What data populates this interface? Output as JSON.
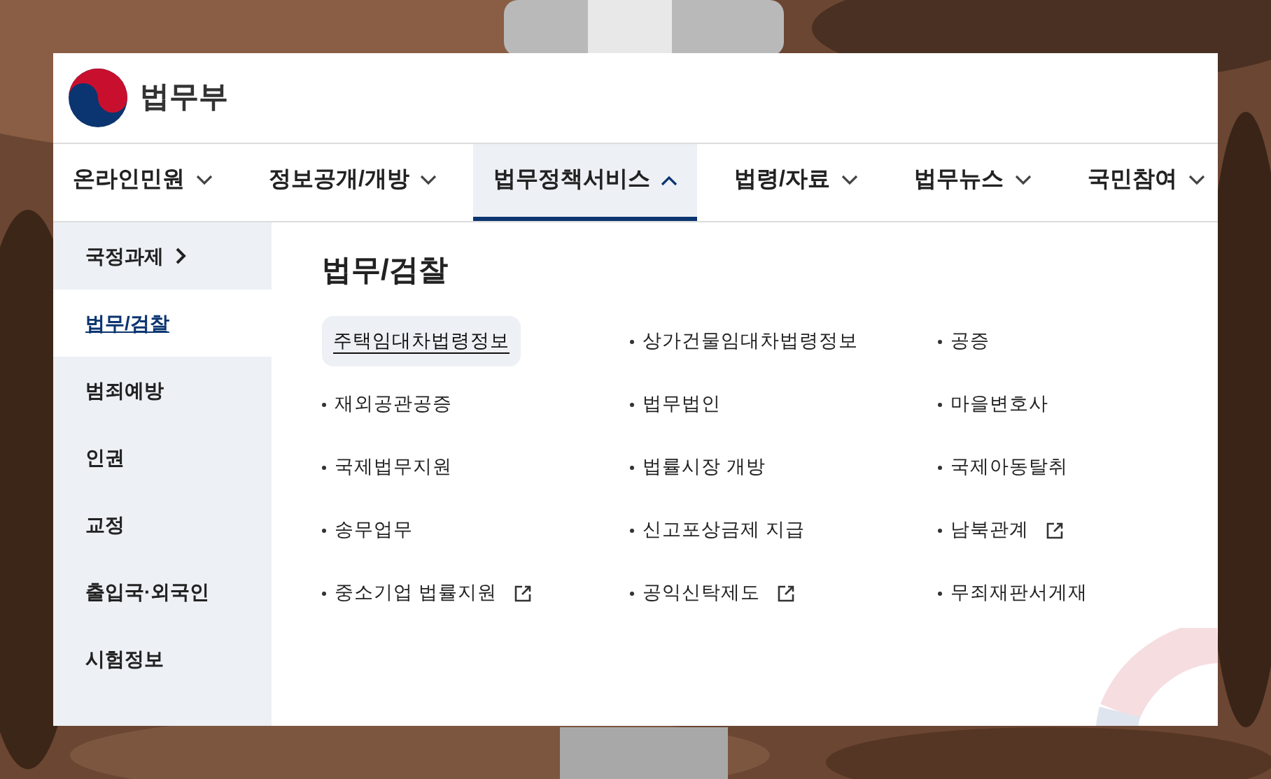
{
  "logo": {
    "name": "법무부"
  },
  "nav": [
    {
      "label": "온라인민원",
      "selected": false,
      "expanded": false
    },
    {
      "label": "정보공개/개방",
      "selected": false,
      "expanded": false
    },
    {
      "label": "법무정책서비스",
      "selected": true,
      "expanded": true
    },
    {
      "label": "법령/자료",
      "selected": false,
      "expanded": false
    },
    {
      "label": "법무뉴스",
      "selected": false,
      "expanded": false
    },
    {
      "label": "국민참여",
      "selected": false,
      "expanded": false
    }
  ],
  "sidebar": {
    "items": [
      {
        "label": "국정과제",
        "selected": false,
        "arrow": true
      },
      {
        "label": "법무/검찰",
        "selected": true,
        "arrow": false
      },
      {
        "label": "범죄예방",
        "selected": false,
        "arrow": false
      },
      {
        "label": "인권",
        "selected": false,
        "arrow": false
      },
      {
        "label": "교정",
        "selected": false,
        "arrow": false
      },
      {
        "label": "출입국·외국인",
        "selected": false,
        "arrow": false
      },
      {
        "label": "시험정보",
        "selected": false,
        "arrow": false
      }
    ]
  },
  "content": {
    "title": "법무/검찰",
    "links": [
      {
        "label": "주택임대차법령정보",
        "selected": true,
        "external": false
      },
      {
        "label": "상가건물임대차법령정보",
        "selected": false,
        "external": false
      },
      {
        "label": "공증",
        "selected": false,
        "external": false
      },
      {
        "label": "재외공관공증",
        "selected": false,
        "external": false
      },
      {
        "label": "법무법인",
        "selected": false,
        "external": false
      },
      {
        "label": "마을변호사",
        "selected": false,
        "external": false
      },
      {
        "label": "국제법무지원",
        "selected": false,
        "external": false
      },
      {
        "label": "법률시장 개방",
        "selected": false,
        "external": false
      },
      {
        "label": "국제아동탈취",
        "selected": false,
        "external": false
      },
      {
        "label": "송무업무",
        "selected": false,
        "external": false
      },
      {
        "label": "신고포상금제 지급",
        "selected": false,
        "external": false
      },
      {
        "label": "남북관계",
        "selected": false,
        "external": true
      },
      {
        "label": "중소기업 법률지원",
        "selected": false,
        "external": true
      },
      {
        "label": "공익신탁제도",
        "selected": false,
        "external": true
      },
      {
        "label": "무죄재판서게재",
        "selected": false,
        "external": false
      }
    ]
  }
}
